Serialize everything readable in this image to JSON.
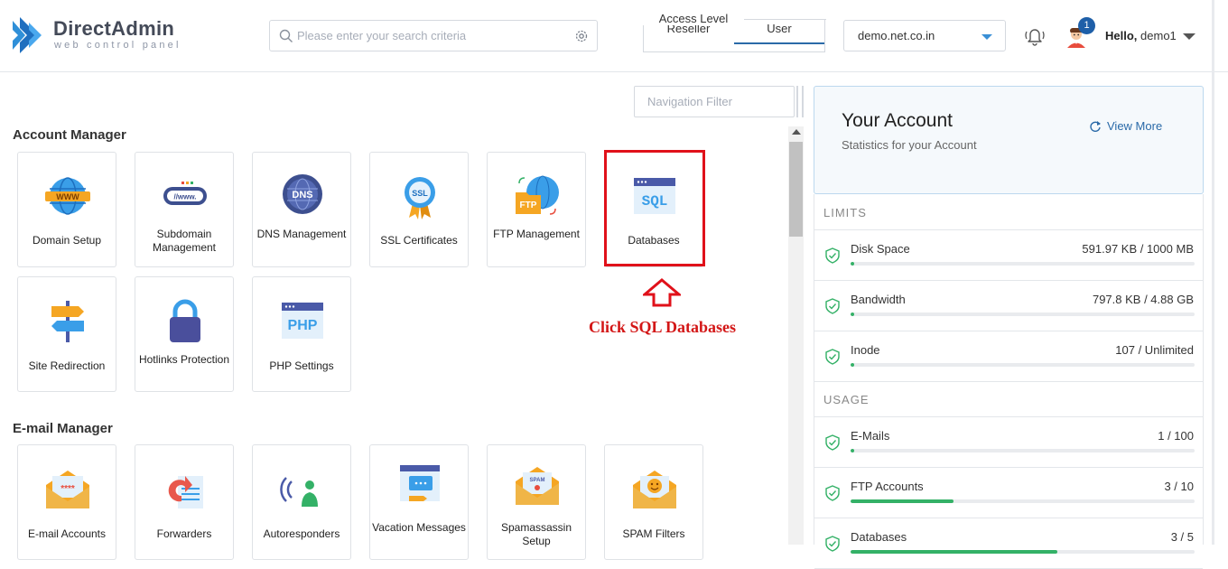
{
  "header": {
    "logo_title": "DirectAdmin",
    "logo_subtitle": "web control panel",
    "search_placeholder": "Please enter your search criteria",
    "access_level_label": "Access Level",
    "access_tabs": [
      "Reseller",
      "User"
    ],
    "access_active": "User",
    "domain": "demo.net.co.in",
    "notification_count": "1",
    "hello_prefix": "Hello,",
    "username": "demo1"
  },
  "nav_filter_placeholder": "Navigation Filter",
  "sections": {
    "account_manager": {
      "title": "Account Manager",
      "tiles": [
        "Domain Setup",
        "Subdomain Management",
        "DNS Management",
        "SSL Certificates",
        "FTP Management",
        "Databases",
        "Site Redirection",
        "Hotlinks Protection",
        "PHP Settings"
      ]
    },
    "email_manager": {
      "title": "E-mail Manager",
      "tiles": [
        "E-mail Accounts",
        "Forwarders",
        "Autoresponders",
        "Vacation Messages",
        "Spamassassin Setup",
        "SPAM Filters"
      ]
    }
  },
  "icon_text": {
    "www": "WWW",
    "subdomain": "//www.",
    "dns": "DNS",
    "ssl": "SSL",
    "ftp": "FTP",
    "sql": "SQL",
    "php": "PHP",
    "password": "****",
    "spam": "SPAM"
  },
  "annotation": "Click SQL Databases",
  "account": {
    "title": "Your Account",
    "subtitle": "Statistics for your Account",
    "view_more": "View More",
    "limits_label": "LIMITS",
    "usage_label": "USAGE",
    "limits": [
      {
        "name": "Disk Space",
        "value": "591.97 KB / 1000 MB",
        "progress": 0.006
      },
      {
        "name": "Bandwidth",
        "value": "797.8 KB / 4.88 GB",
        "progress": 0.002
      },
      {
        "name": "Inode",
        "value": "107 / Unlimited",
        "progress": 0.0
      }
    ],
    "usage": [
      {
        "name": "E-Mails",
        "value": "1 / 100",
        "progress": 0.01
      },
      {
        "name": "FTP Accounts",
        "value": "3 / 10",
        "progress": 0.3
      },
      {
        "name": "Databases",
        "value": "3 / 5",
        "progress": 0.6
      }
    ]
  },
  "colors": {
    "accent": "#2a6aa8",
    "highlight": "#e0111a",
    "progress": "#34b167"
  }
}
